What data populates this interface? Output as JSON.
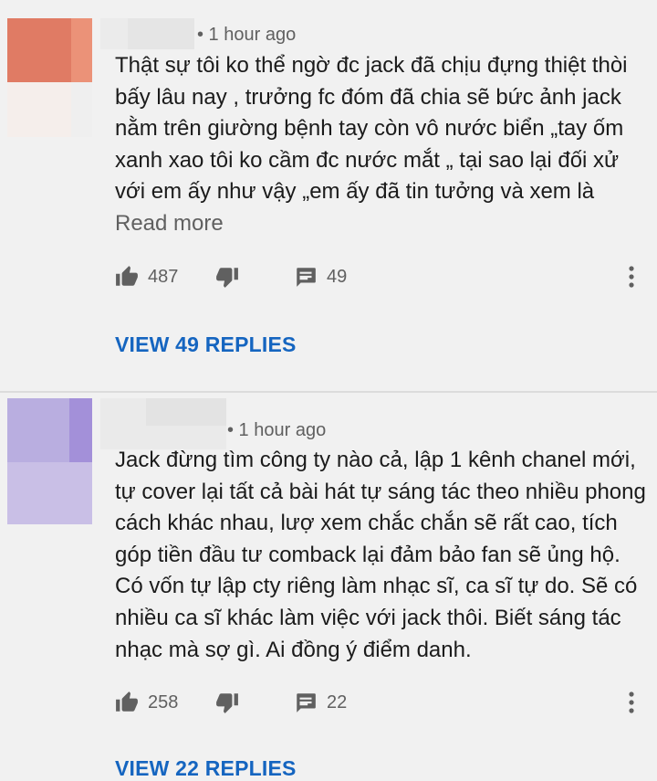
{
  "comments": [
    {
      "timestamp": "• 1 hour ago",
      "text": "Thật sự tôi ko thể ngờ đc jack đã chịu đựng thiệt thòi bấy lâu nay , trưởng fc đóm đã chia sẽ bức ảnh jack nằm trên giường bệnh tay còn vô nước biển „tay ốm xanh xao tôi ko cầm đc nước mắt „ tại sao lại đối xử với em ấy như vậy „em ấy đã tin tưởng và xem là",
      "read_more": "Read more",
      "likes": "487",
      "replies_count": "49",
      "view_replies": "VIEW 49 REPLIES",
      "avatar_colors": [
        "#e07b64",
        "#e88f70",
        "#f3ece8",
        "#e9d8d0"
      ],
      "username_colors": [
        "#ececec",
        "#e4e4e4"
      ],
      "icons": {
        "like": "thumbs-up-icon",
        "dislike": "thumbs-down-icon",
        "reply": "comment-icon",
        "more": "more-vert-icon"
      }
    },
    {
      "timestamp": "• 1 hour ago",
      "text": "Jack đừng tìm công ty nào cả, lập 1 kênh chanel mới, tự cover lại tất cả bài hát tự sáng tác theo nhiều phong cách khác nhau, lượ xem chắc chắn sẽ rất cao, tích góp tiền đầu tư comback lại đảm bảo fan sẽ ủng hộ. Có vốn tự lập cty riêng làm nhạc sĩ, ca sĩ tự do. Sẽ có nhiều ca sĩ khác làm việc với jack thôi. Biết sáng tác nhạc mà sợ gì. Ai đồng ý điểm danh.",
      "likes": "258",
      "replies_count": "22",
      "view_replies": "VIEW 22 REPLIES",
      "avatar_colors": [
        "#b9aee0",
        "#a896d8",
        "#cfc6ea",
        "#e2dcf2"
      ],
      "username_colors": [
        "#e9e9e9",
        "#e2e2e2"
      ],
      "icons": {
        "like": "thumbs-up-icon",
        "dislike": "thumbs-down-icon",
        "reply": "comment-icon",
        "more": "more-vert-icon"
      }
    }
  ],
  "colors": {
    "background": "#f1f1f1",
    "link_blue": "#1565c0",
    "icon_gray": "#606060"
  }
}
